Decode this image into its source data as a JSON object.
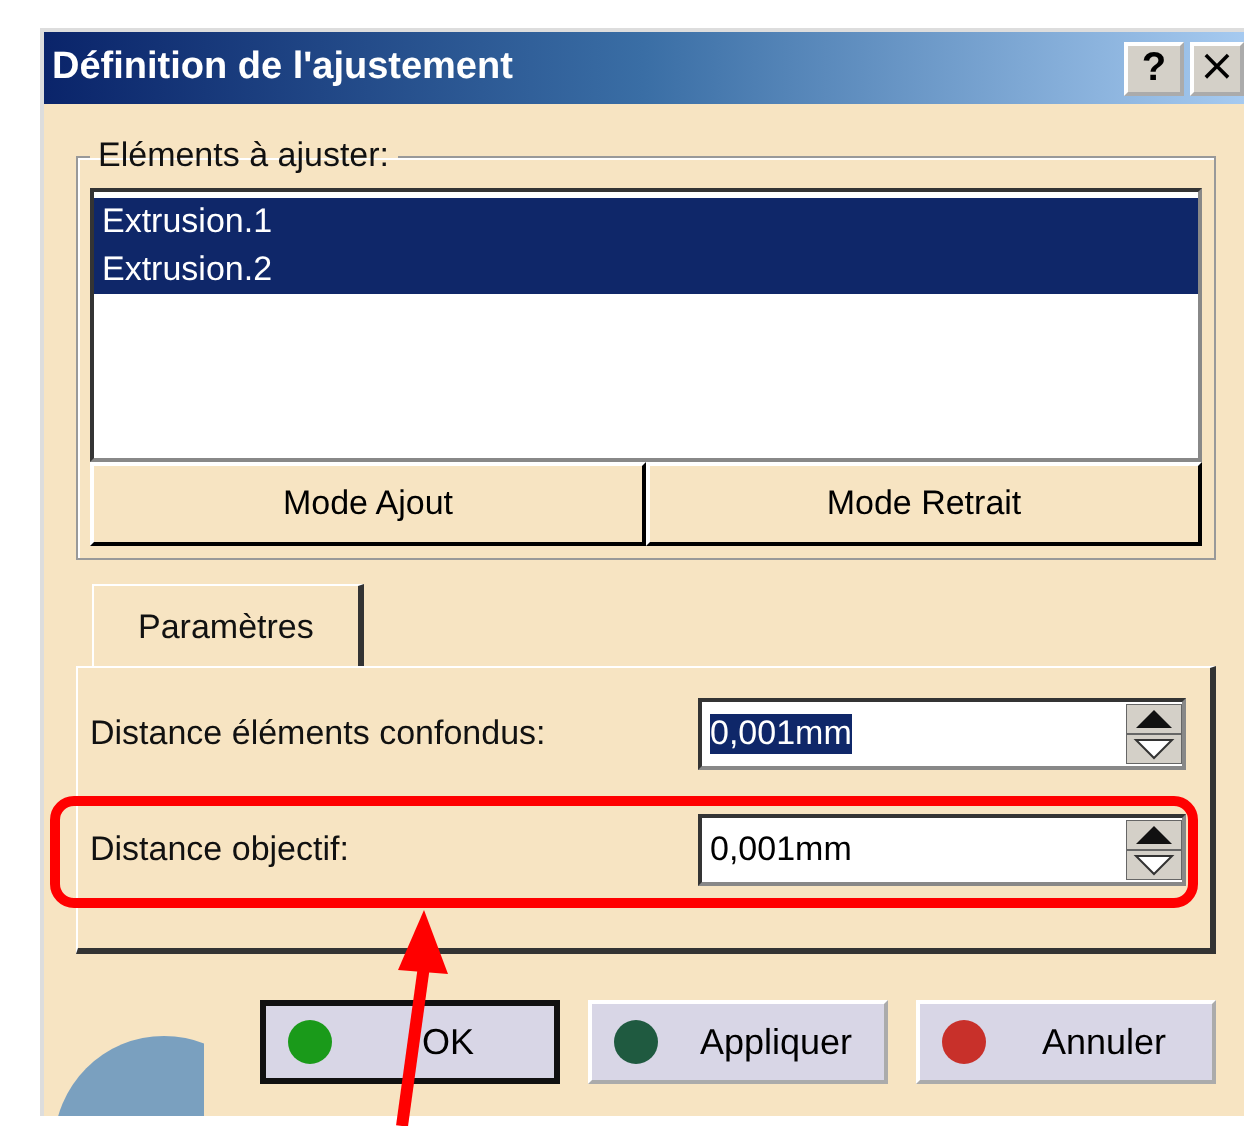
{
  "window": {
    "title": "Définition de l'ajustement",
    "title_buttons": [
      {
        "kind": "help",
        "label": "?"
      },
      {
        "kind": "close",
        "label": "×"
      }
    ]
  },
  "group": {
    "label": "Eléments à ajuster:",
    "items": [
      {
        "label": "Extrusion.1",
        "selected": true
      },
      {
        "label": "Extrusion.2",
        "selected": true
      }
    ],
    "buttons": [
      "Mode Ajout",
      "Mode Retrait"
    ]
  },
  "tabs": [
    {
      "label": "Paramètres",
      "selected": true
    }
  ],
  "fields": [
    {
      "label": "Distance éléments confondus:",
      "value": "0,001mm",
      "value_selected": true
    },
    {
      "label": "Distance objectif:",
      "value": "0,001mm",
      "value_selected": false,
      "highlighted": true
    }
  ],
  "buttons": [
    {
      "label": "OK",
      "color": "#1a9a1a",
      "default": true
    },
    {
      "label": "Appliquer",
      "color": "#1f5a40",
      "default": false
    },
    {
      "label": "Annuler",
      "color": "#c8302a",
      "default": false
    }
  ]
}
